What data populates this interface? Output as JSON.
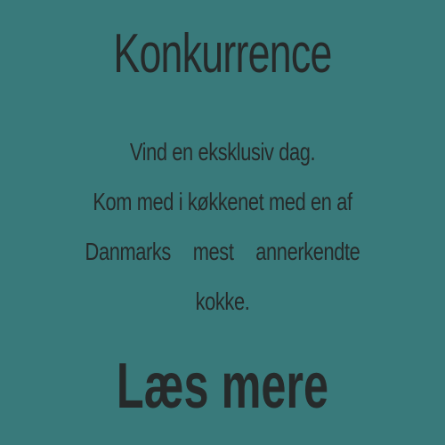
{
  "colors": {
    "background": "#397a7b",
    "text": "#262a2a"
  },
  "banner": {
    "title": "Konkurrence",
    "lines": [
      "Vind en eksklusiv dag.",
      "Kom med i køkkenet med en af",
      "Danmarks",
      "mest",
      "annerkendte",
      "kokke."
    ],
    "cta": "Læs mere"
  }
}
